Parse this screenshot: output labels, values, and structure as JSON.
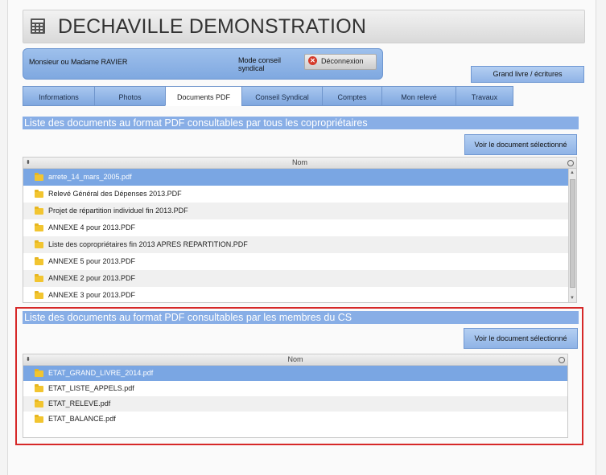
{
  "header": {
    "title": "DECHAVILLE DEMONSTRATION"
  },
  "user": {
    "name": "Monsieur ou Madame RAVIER",
    "mode": "Mode conseil syndical",
    "logout_label": "Déconnexion"
  },
  "grand_livre_label": "Grand livre / écritures",
  "tabs": [
    {
      "label": "Informations"
    },
    {
      "label": "Photos"
    },
    {
      "label": "Documents PDF"
    },
    {
      "label": "Conseil Syndical"
    },
    {
      "label": "Comptes"
    },
    {
      "label": "Mon relevé"
    },
    {
      "label": "Travaux"
    }
  ],
  "section1": {
    "title": "Liste des documents au format PDF consultables par tous les copropriétaires",
    "view_button": "Voir le document sélectionné",
    "column": "Nom",
    "rows": [
      "arrete_14_mars_2005.pdf",
      "Relevé Général des Dépenses 2013.PDF",
      "Projet de répartition individuel fin 2013.PDF",
      "ANNEXE 4 pour 2013.PDF",
      "Liste des copropriétaires fin 2013 APRES REPARTITION.PDF",
      "ANNEXE 5 pour 2013.PDF",
      "ANNEXE 2 pour 2013.PDF",
      "ANNEXE 3 pour 2013.PDF"
    ]
  },
  "section2": {
    "title": "Liste des documents au format PDF consultables par les membres du CS",
    "view_button": "Voir le document sélectionné",
    "column": "Nom",
    "rows": [
      "ETAT_GRAND_LIVRE_2014.pdf",
      "ETAT_LISTE_APPELS.pdf",
      "ETAT_RELEVE.pdf",
      "ETAT_BALANCE.pdf"
    ]
  },
  "colors": {
    "accent": "#88aee6",
    "selected_row": "#7aa6e3",
    "highlight_border": "#d62828",
    "folder": "#f2c530"
  }
}
